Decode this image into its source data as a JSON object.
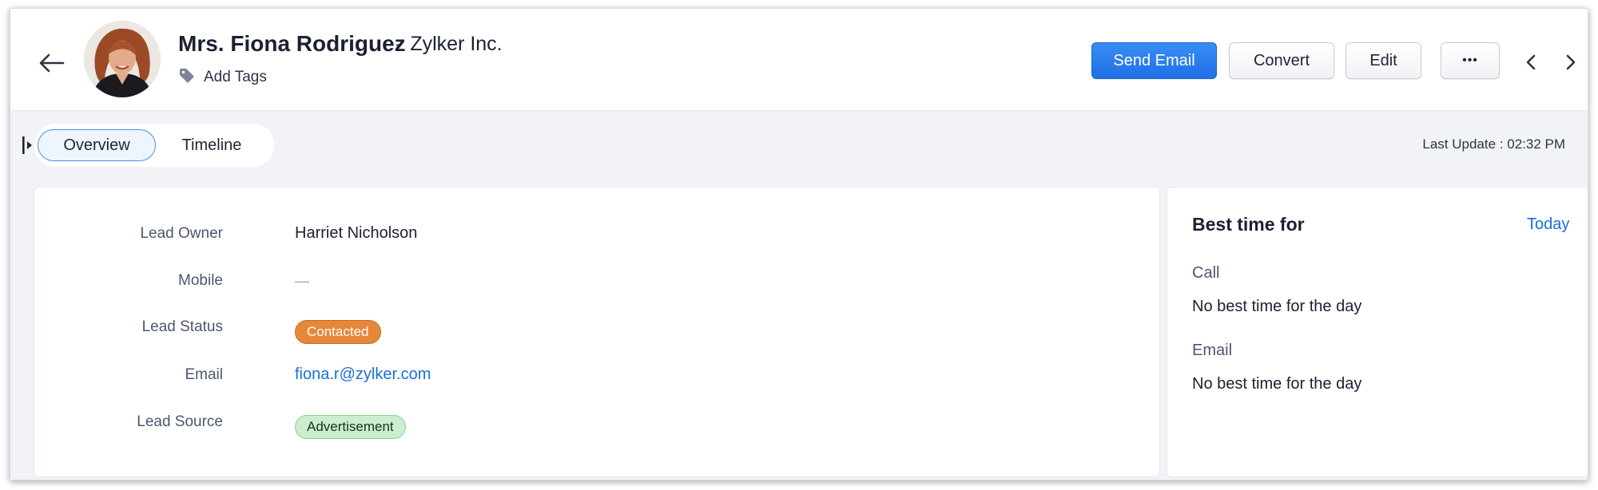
{
  "header": {
    "name": "Mrs. Fiona Rodriguez",
    "company_separator": "-",
    "company": "Zylker Inc.",
    "add_tags_label": "Add Tags",
    "buttons": {
      "send_email": "Send Email",
      "convert": "Convert",
      "edit": "Edit",
      "more": "•••"
    }
  },
  "tabs": [
    {
      "label": "Overview",
      "active": true
    },
    {
      "label": "Timeline",
      "active": false
    }
  ],
  "last_update": "Last Update : 02:32 PM",
  "details": {
    "lead_owner": {
      "label": "Lead Owner",
      "value": "Harriet Nicholson"
    },
    "mobile": {
      "label": "Mobile",
      "value": "—"
    },
    "lead_status": {
      "label": "Lead Status",
      "value": "Contacted"
    },
    "email": {
      "label": "Email",
      "value": "fiona.r@zylker.com"
    },
    "lead_source": {
      "label": "Lead Source",
      "value": "Advertisement"
    }
  },
  "best_time": {
    "title": "Best time for",
    "period_link": "Today",
    "call_label": "Call",
    "call_value": "No best time for the day",
    "email_label": "Email",
    "email_value": "No best time for the day"
  },
  "colors": {
    "primary": "#1f71e6",
    "status_badge": "#e5883a",
    "source_badge": "#cdeecd",
    "link": "#1a6fd8"
  },
  "icons": [
    "back-arrow-icon",
    "tag-icon",
    "more-icon",
    "chevron-left-icon",
    "chevron-right-icon",
    "sidebar-toggle-icon"
  ]
}
